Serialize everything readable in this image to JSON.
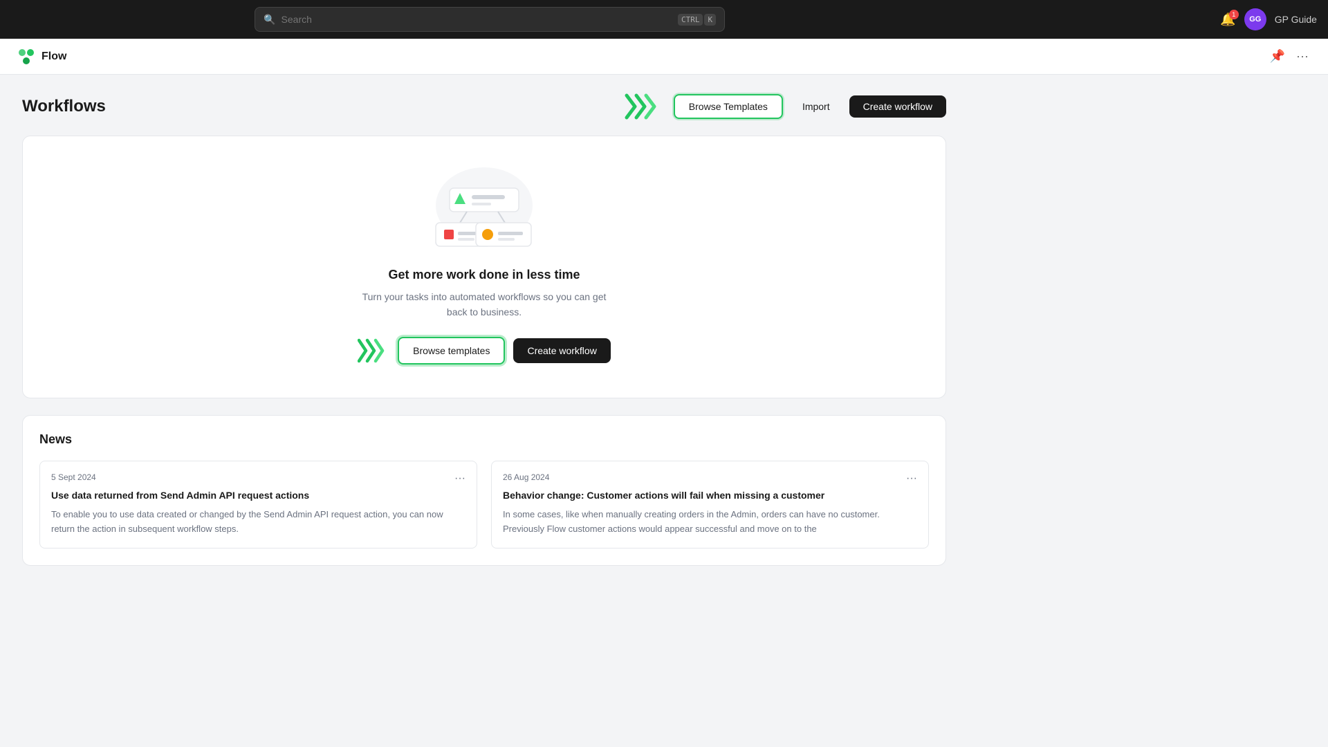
{
  "topnav": {
    "search_placeholder": "Search",
    "shortcut_ctrl": "CTRL",
    "shortcut_k": "K",
    "notification_count": "1",
    "user_initials": "GG",
    "user_name": "GP Guide"
  },
  "page_header": {
    "app_name": "Flow"
  },
  "workflows": {
    "title": "Workflows",
    "browse_templates_label": "Browse Templates",
    "import_label": "Import",
    "create_workflow_label": "Create workflow"
  },
  "empty_state": {
    "title": "Get more work done in less time",
    "description": "Turn your tasks into automated workflows so you can get back to business.",
    "browse_templates_label": "Browse templates",
    "create_workflow_label": "Create workflow"
  },
  "news": {
    "title": "News",
    "items": [
      {
        "date": "5 Sept 2024",
        "title": "Use data returned from Send Admin API request actions",
        "body": "To enable you to use data created or changed by the Send Admin API request action, you can now return the action in subsequent workflow steps."
      },
      {
        "date": "26 Aug 2024",
        "title": "Behavior change: Customer actions will fail when missing a customer",
        "body": "In some cases, like when manually creating orders in the Admin, orders can have no customer. Previously Flow customer actions would appear successful and move on to the"
      }
    ]
  }
}
